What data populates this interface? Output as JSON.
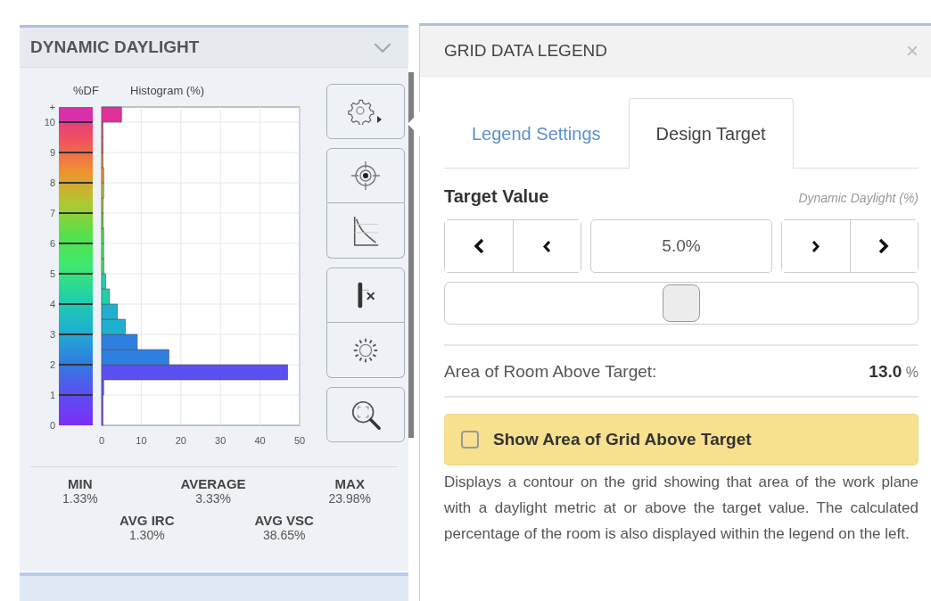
{
  "left_panel": {
    "title": "DYNAMIC DAYLIGHT",
    "expanded": true,
    "chart": {
      "chart_data": {
        "type": "bar",
        "orientation": "horizontal",
        "title": "Histogram (%)",
        "ylabel": "%DF",
        "xlim": [
          0,
          50
        ],
        "xticks": [
          0,
          10,
          20,
          30,
          40,
          50
        ],
        "yticks": [
          0,
          1,
          2,
          3,
          4,
          5,
          6,
          7,
          8,
          9,
          10,
          {
            "value": 10.5,
            "label": "+"
          }
        ],
        "grid": true,
        "ylim": [
          0,
          10.5
        ],
        "x": [
          0.25,
          0.75,
          1.25,
          1.75,
          2.25,
          2.75,
          3.25,
          3.75,
          4.25,
          4.75,
          5.25,
          5.75,
          6.25,
          6.75,
          7.25,
          7.75,
          8.25,
          8.75,
          9.25,
          9.75,
          10.25
        ],
        "values": [
          0,
          0,
          0.5,
          47,
          17,
          9,
          6,
          4,
          2,
          1,
          0.6,
          0.5,
          0.5,
          0.4,
          0.4,
          0.5,
          0.5,
          0.3,
          0.2,
          0.2,
          5
        ]
      }
    },
    "stats": [
      {
        "label": "MIN",
        "value": "1.33%"
      },
      {
        "label": "AVERAGE",
        "value": "3.33%"
      },
      {
        "label": "MAX",
        "value": "23.98%"
      },
      {
        "label": "AVG IRC",
        "value": "1.30%"
      },
      {
        "label": "AVG VSC",
        "value": "38.65%"
      }
    ]
  },
  "right_panel": {
    "title": "GRID DATA LEGEND",
    "close": "×",
    "tabs": [
      {
        "label": "Legend Settings",
        "selected": false
      },
      {
        "label": "Design Target",
        "selected": true
      }
    ],
    "target_label": "Target Value",
    "metric": "Dynamic Daylight (%)",
    "stepper": {
      "value": "5.0%"
    },
    "slider": {
      "level": 0.5
    },
    "area": {
      "label": "Area of Room Above Target:",
      "value": "13.0",
      "unit": "%"
    },
    "checkbox": {
      "label": "Show Area of Grid Above Target",
      "checked": false
    },
    "description": "Displays a contour on the grid showing that area of the work plane with a daylight metric at or above the target value. The calculated percentage of the room is also displayed within the legend on the left."
  }
}
